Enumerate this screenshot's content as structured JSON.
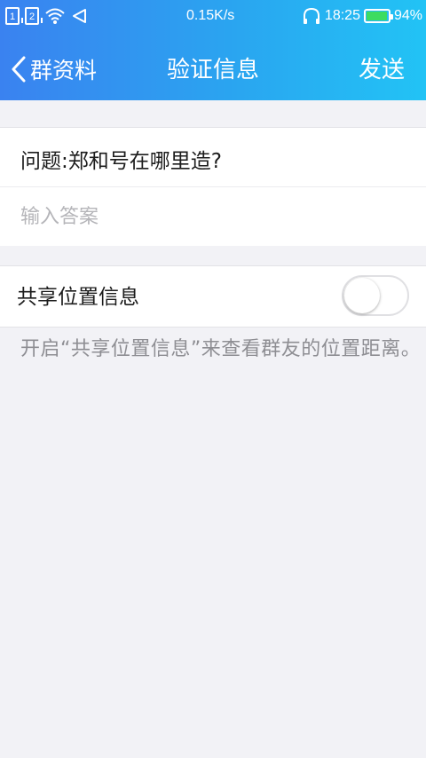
{
  "status_bar": {
    "sim1": "1",
    "sim2": "2",
    "net_speed": "0.15K/s",
    "time": "18:25",
    "battery_percent": "94%",
    "battery_level": 0.94
  },
  "nav": {
    "back_label": "群资料",
    "title": "验证信息",
    "send_label": "发送"
  },
  "form": {
    "question": "问题:郑和号在哪里造?",
    "answer_value": "",
    "answer_placeholder": "输入答案"
  },
  "location_share": {
    "label": "共享位置信息",
    "enabled": false,
    "hint": "开启“共享位置信息”来查看群友的位置距离。"
  },
  "colors": {
    "header_gradient_start": "#3a82f0",
    "header_gradient_end": "#22c3f5",
    "battery": "#3ddc60"
  }
}
